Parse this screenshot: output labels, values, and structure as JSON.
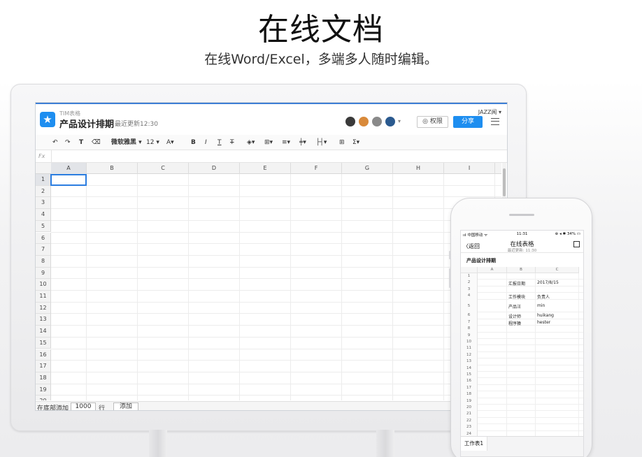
{
  "hero": {
    "title": "在线文档",
    "subtitle": "在线Word/Excel，多端多人随时编辑。"
  },
  "desktop": {
    "brand": "TIM表格",
    "doc_title": "产品设计排期",
    "last_edited": "最近更新12:30",
    "user_name": "JAZZ闻 ▾",
    "permission_label": "◎ 权限",
    "share_label": "分享",
    "toolbar": {
      "undo": "↶",
      "redo": "↷",
      "format_painter": "T",
      "clear": "⌫",
      "font": "微软雅黑 ▾",
      "size": "12 ▾",
      "font_color": "A▾",
      "bold": "B",
      "italic": "I",
      "underline": "T",
      "strike": "T",
      "fill": "◈▾",
      "border": "⊞▾",
      "align": "≡▾",
      "valign": "╪▾",
      "merge": "├┤▾",
      "freeze": "⊞",
      "sum": "Σ▾"
    },
    "fx_label": "Fx",
    "columns": [
      "A",
      "B",
      "C",
      "D",
      "E",
      "F",
      "G",
      "H",
      "I"
    ],
    "rows": [
      "1",
      "2",
      "3",
      "4",
      "5",
      "6",
      "7",
      "8",
      "9",
      "10",
      "11",
      "12",
      "13",
      "14",
      "15",
      "16",
      "17",
      "18",
      "19",
      "20"
    ],
    "footer": {
      "prefix": "在底部添加",
      "count": "1000",
      "unit": "行",
      "add_button": "添加"
    },
    "avatar_colors": [
      "#3a3a3a",
      "#d98a3a",
      "#8a8a8a",
      "#2b5a8f"
    ]
  },
  "phone": {
    "status_left": "ııl 中国移动 ᯤ",
    "status_time": "11:31",
    "status_right": "⊕ ◂ ✱ 34% ▭",
    "back": "〈返回",
    "title": "在线表格",
    "updated": "最近更新: 11:30",
    "sheet_title": "产品设计排期",
    "columns": [
      "A",
      "B",
      "C"
    ],
    "rows": [
      "1",
      "2",
      "3",
      "4",
      "5",
      "6",
      "7",
      "8",
      "9",
      "10",
      "11",
      "12",
      "13",
      "14",
      "15",
      "16",
      "17",
      "18",
      "19",
      "20",
      "21",
      "22",
      "23",
      "24"
    ],
    "cells": {
      "r2b": "汇报日期",
      "r2c": "2017/8/15",
      "r4b": "工作模块",
      "r4c": "负责人",
      "r5b": "产品汪",
      "r5c": "min",
      "r6b": "设计师",
      "r6c": "huikang",
      "r7b": "程序猿",
      "r7c": "hester"
    },
    "tab": "工作表1"
  }
}
